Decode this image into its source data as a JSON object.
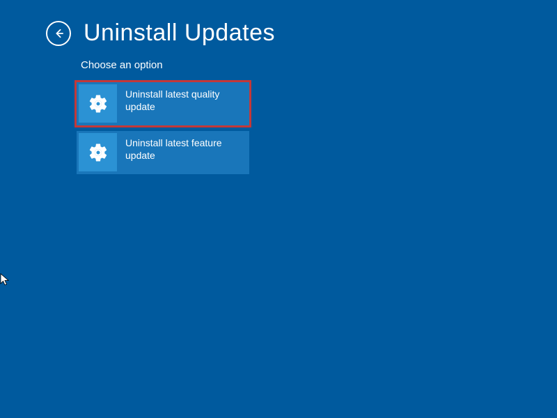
{
  "header": {
    "title": "Uninstall Updates"
  },
  "subtitle": "Choose an option",
  "options": [
    {
      "label": "Uninstall latest quality update",
      "highlighted": true
    },
    {
      "label": "Uninstall latest feature update",
      "highlighted": false
    }
  ],
  "colors": {
    "background": "#005a9e",
    "tile": "#1976ba",
    "tileIcon": "#2b92d4",
    "highlight": "#c43838"
  }
}
